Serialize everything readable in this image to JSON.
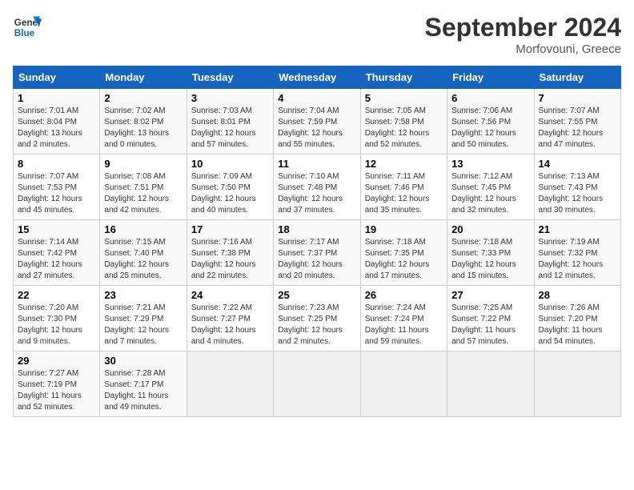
{
  "logo": {
    "line1": "General",
    "line2": "Blue"
  },
  "title": "September 2024",
  "location": "Morfovouni, Greece",
  "days_of_week": [
    "Sunday",
    "Monday",
    "Tuesday",
    "Wednesday",
    "Thursday",
    "Friday",
    "Saturday"
  ],
  "weeks": [
    [
      {
        "day": "1",
        "sunrise": "7:01 AM",
        "sunset": "8:04 PM",
        "daylight": "13 hours and 2 minutes."
      },
      {
        "day": "2",
        "sunrise": "7:02 AM",
        "sunset": "8:02 PM",
        "daylight": "13 hours and 0 minutes."
      },
      {
        "day": "3",
        "sunrise": "7:03 AM",
        "sunset": "8:01 PM",
        "daylight": "12 hours and 57 minutes."
      },
      {
        "day": "4",
        "sunrise": "7:04 AM",
        "sunset": "7:59 PM",
        "daylight": "12 hours and 55 minutes."
      },
      {
        "day": "5",
        "sunrise": "7:05 AM",
        "sunset": "7:58 PM",
        "daylight": "12 hours and 52 minutes."
      },
      {
        "day": "6",
        "sunrise": "7:06 AM",
        "sunset": "7:56 PM",
        "daylight": "12 hours and 50 minutes."
      },
      {
        "day": "7",
        "sunrise": "7:07 AM",
        "sunset": "7:55 PM",
        "daylight": "12 hours and 47 minutes."
      }
    ],
    [
      {
        "day": "8",
        "sunrise": "7:07 AM",
        "sunset": "7:53 PM",
        "daylight": "12 hours and 45 minutes."
      },
      {
        "day": "9",
        "sunrise": "7:08 AM",
        "sunset": "7:51 PM",
        "daylight": "12 hours and 42 minutes."
      },
      {
        "day": "10",
        "sunrise": "7:09 AM",
        "sunset": "7:50 PM",
        "daylight": "12 hours and 40 minutes."
      },
      {
        "day": "11",
        "sunrise": "7:10 AM",
        "sunset": "7:48 PM",
        "daylight": "12 hours and 37 minutes."
      },
      {
        "day": "12",
        "sunrise": "7:11 AM",
        "sunset": "7:46 PM",
        "daylight": "12 hours and 35 minutes."
      },
      {
        "day": "13",
        "sunrise": "7:12 AM",
        "sunset": "7:45 PM",
        "daylight": "12 hours and 32 minutes."
      },
      {
        "day": "14",
        "sunrise": "7:13 AM",
        "sunset": "7:43 PM",
        "daylight": "12 hours and 30 minutes."
      }
    ],
    [
      {
        "day": "15",
        "sunrise": "7:14 AM",
        "sunset": "7:42 PM",
        "daylight": "12 hours and 27 minutes."
      },
      {
        "day": "16",
        "sunrise": "7:15 AM",
        "sunset": "7:40 PM",
        "daylight": "12 hours and 25 minutes."
      },
      {
        "day": "17",
        "sunrise": "7:16 AM",
        "sunset": "7:38 PM",
        "daylight": "12 hours and 22 minutes."
      },
      {
        "day": "18",
        "sunrise": "7:17 AM",
        "sunset": "7:37 PM",
        "daylight": "12 hours and 20 minutes."
      },
      {
        "day": "19",
        "sunrise": "7:18 AM",
        "sunset": "7:35 PM",
        "daylight": "12 hours and 17 minutes."
      },
      {
        "day": "20",
        "sunrise": "7:18 AM",
        "sunset": "7:33 PM",
        "daylight": "12 hours and 15 minutes."
      },
      {
        "day": "21",
        "sunrise": "7:19 AM",
        "sunset": "7:32 PM",
        "daylight": "12 hours and 12 minutes."
      }
    ],
    [
      {
        "day": "22",
        "sunrise": "7:20 AM",
        "sunset": "7:30 PM",
        "daylight": "12 hours and 9 minutes."
      },
      {
        "day": "23",
        "sunrise": "7:21 AM",
        "sunset": "7:29 PM",
        "daylight": "12 hours and 7 minutes."
      },
      {
        "day": "24",
        "sunrise": "7:22 AM",
        "sunset": "7:27 PM",
        "daylight": "12 hours and 4 minutes."
      },
      {
        "day": "25",
        "sunrise": "7:23 AM",
        "sunset": "7:25 PM",
        "daylight": "12 hours and 2 minutes."
      },
      {
        "day": "26",
        "sunrise": "7:24 AM",
        "sunset": "7:24 PM",
        "daylight": "11 hours and 59 minutes."
      },
      {
        "day": "27",
        "sunrise": "7:25 AM",
        "sunset": "7:22 PM",
        "daylight": "11 hours and 57 minutes."
      },
      {
        "day": "28",
        "sunrise": "7:26 AM",
        "sunset": "7:20 PM",
        "daylight": "11 hours and 54 minutes."
      }
    ],
    [
      {
        "day": "29",
        "sunrise": "7:27 AM",
        "sunset": "7:19 PM",
        "daylight": "11 hours and 52 minutes."
      },
      {
        "day": "30",
        "sunrise": "7:28 AM",
        "sunset": "7:17 PM",
        "daylight": "11 hours and 49 minutes."
      },
      null,
      null,
      null,
      null,
      null
    ]
  ]
}
